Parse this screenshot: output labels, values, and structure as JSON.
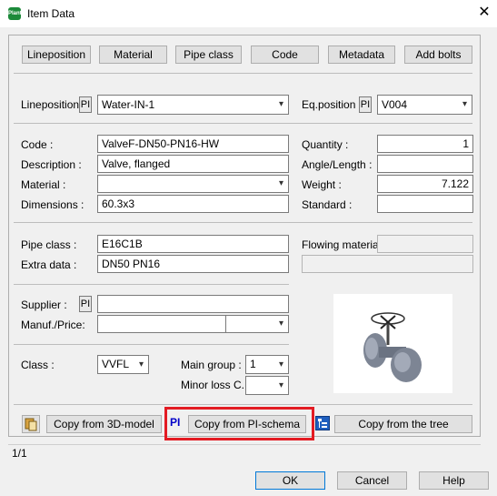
{
  "window": {
    "title": "Item Data",
    "app_icon": "Plant"
  },
  "tabs": [
    "Lineposition",
    "Material",
    "Pipe class",
    "Code",
    "Metadata",
    "Add bolts"
  ],
  "line": {
    "lineposition_label": "Lineposition :",
    "lineposition_value": "Water-IN-1",
    "eq_label": "Eq.position :",
    "eq_value": "V004",
    "pi_text": "PI"
  },
  "item": {
    "code_label": "Code :",
    "code_value": "ValveF-DN50-PN16-HW",
    "description_label": "Description :",
    "description_value": "Valve, flanged",
    "material_label": "Material :",
    "material_value": "",
    "dimensions_label": "Dimensions :",
    "dimensions_value": "60.3x3",
    "quantity_label": "Quantity :",
    "quantity_value": "1",
    "angle_label": "Angle/Length :",
    "angle_value": "",
    "weight_label": "Weight :",
    "weight_value": "7.122",
    "standard_label": "Standard :",
    "standard_value": ""
  },
  "pipe": {
    "pipe_class_label": "Pipe class :",
    "pipe_class_value": "E16C1B",
    "extra_label": "Extra data :",
    "extra_value": "DN50 PN16",
    "flowing_label": "Flowing material :",
    "flowing_value": ""
  },
  "supplier": {
    "supplier_label": "Supplier :",
    "supplier_value": "",
    "manuf_label": "Manuf./Price:",
    "manuf_value": "",
    "price_value": ""
  },
  "classes": {
    "class_label": "Class :",
    "class_value": "VVFL",
    "main_group_label": "Main group :",
    "main_group_value": "1",
    "minor_loss_label": "Minor loss C. :",
    "minor_loss_value": ""
  },
  "copy_buttons": {
    "copy_3d": "Copy from 3D-model",
    "pi_icon_text": "PI",
    "copy_pi": "Copy from PI-schema",
    "copy_tree": "Copy from the tree"
  },
  "status": {
    "page": "1/1"
  },
  "dialog_buttons": {
    "ok": "OK",
    "cancel": "Cancel",
    "help": "Help"
  },
  "colors": {
    "highlight": "#e31b23",
    "app_icon": "#1c8a3a",
    "pi_text": "#0000c8"
  }
}
